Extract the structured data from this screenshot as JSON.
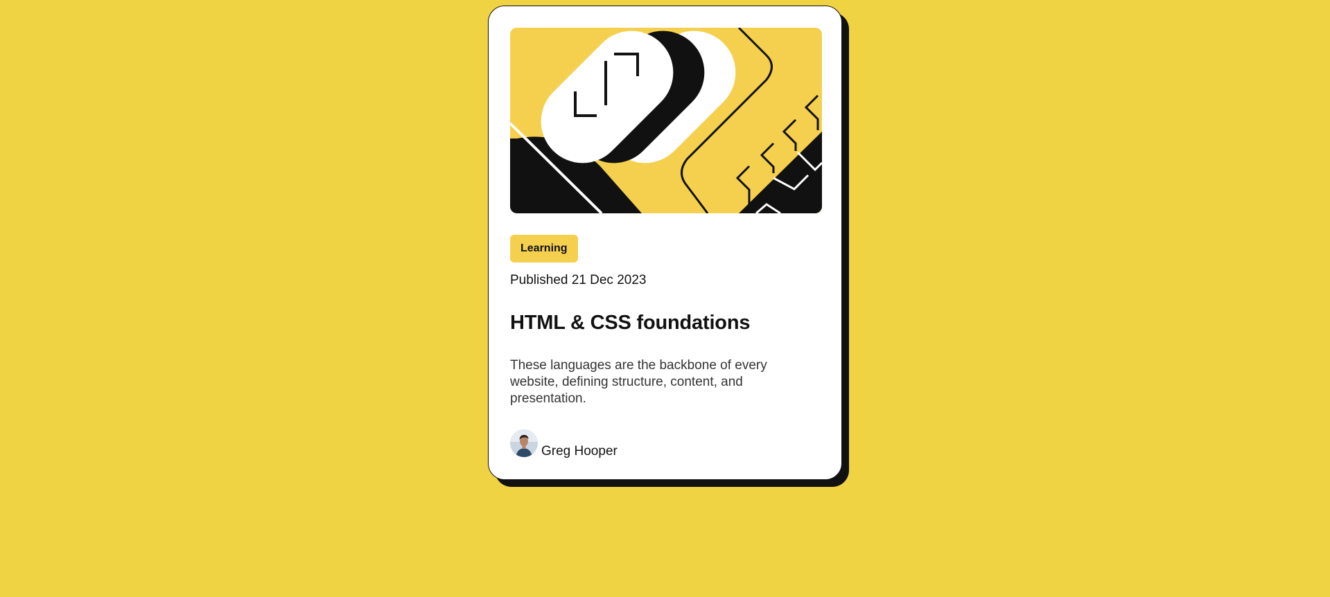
{
  "colors": {
    "background": "#F0D343",
    "accent": "#F4D04E",
    "card": "#FFFFFF",
    "ink": "#111111",
    "text": "#333333"
  },
  "card": {
    "hero_image": "illustration-article",
    "tag": "Learning",
    "published": "Published 21 Dec 2023",
    "title": "HTML & CSS foundations",
    "description": "These languages are the backbone of every website, defining structure, content, and presentation.",
    "author": {
      "avatar": "avatar-image",
      "name": "Greg Hooper"
    }
  }
}
